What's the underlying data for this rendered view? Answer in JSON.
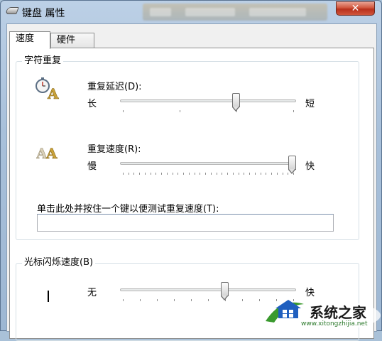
{
  "window": {
    "title": "键盘 属性",
    "close_glyph": "✕"
  },
  "tabs": [
    {
      "label": "速度",
      "active": true
    },
    {
      "label": "硬件",
      "active": false
    }
  ],
  "character_repeat": {
    "group_title": "字符重复",
    "repeat_delay": {
      "label": "重复延迟(D):",
      "min_label": "长",
      "max_label": "短",
      "value": 2,
      "max": 3
    },
    "repeat_rate": {
      "label": "重复速度(R):",
      "min_label": "慢",
      "max_label": "快",
      "value": 31,
      "max": 31
    },
    "test_label": "单击此处并按住一个键以便测试重复速度(T):",
    "test_value": ""
  },
  "cursor_blink": {
    "group_title": "光标闪烁速度(B)",
    "min_label": "无",
    "max_label": "快",
    "value": 0.6
  },
  "watermark": {
    "text": "系统之家",
    "url": "www.xitongzhijia.net"
  },
  "icons": [
    "keyboard-icon",
    "repeat-delay-icon",
    "repeat-rate-icon",
    "blink-cursor-icon",
    "close-icon"
  ]
}
